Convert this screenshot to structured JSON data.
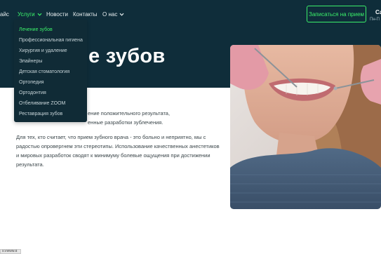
{
  "nav": {
    "items": [
      {
        "label": "айс"
      },
      {
        "label": "Услуги"
      },
      {
        "label": "Новости"
      },
      {
        "label": "Контакты"
      },
      {
        "label": "О нас"
      }
    ],
    "cta_label": "Записаться на прием",
    "contact_partial": "Са",
    "hours_partial": "Пн-П"
  },
  "dropdown": {
    "items": [
      {
        "label": "Лечение зубов"
      },
      {
        "label": "Профессиональная гигиена"
      },
      {
        "label": "Хирургия и удаление"
      },
      {
        "label": "Элайнеры"
      },
      {
        "label": "Детская стоматология"
      },
      {
        "label": "Ортопедия"
      },
      {
        "label": "Ортодонтия"
      },
      {
        "label": "Отбеливание ZOOM"
      },
      {
        "label": "Реставрация зубов"
      }
    ]
  },
  "hero": {
    "title_partial": "е зубов"
  },
  "content": {
    "p1_line1": "ение положительного результата,",
    "p1_line2": "енные разработки зублечения.",
    "p2": "Для тех, кто считает, что прием зубного врача - это больно и неприятно, мы с радостью опровергнем эти стереотипы. Использование качественных анестетиков и мировых разработок сводят к минимуму болевые ощущения при достижении результата."
  },
  "status_text": "s://www.d",
  "colors": {
    "accent": "#3bf06a",
    "hero_bg": "#0f2d3a",
    "dropdown_bg": "#102b36"
  }
}
